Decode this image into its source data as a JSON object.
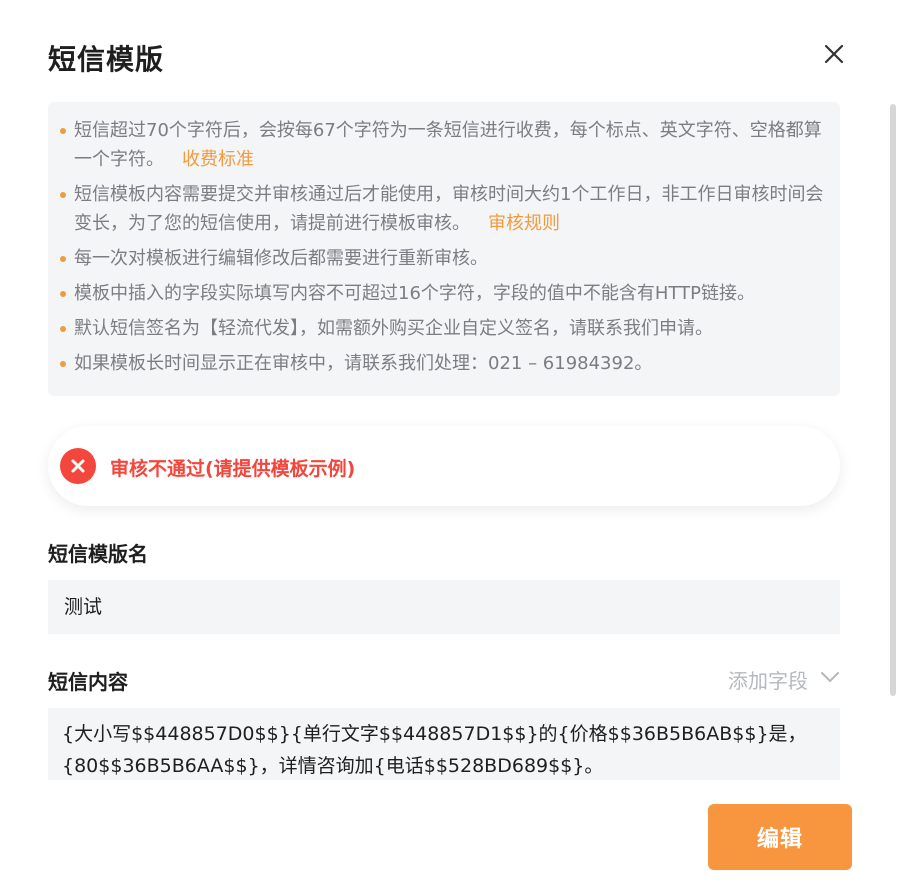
{
  "dialog": {
    "title": "短信模版"
  },
  "notice": {
    "items": [
      {
        "text": "短信超过70个字符后，会按每67个字符为一条短信进行收费，每个标点、英文字符、空格都算一个字符。",
        "link": "收费标准"
      },
      {
        "text": "短信模板内容需要提交并审核通过后才能使用，审核时间大约1个工作日，非工作日审核时间会变长，为了您的短信使用，请提前进行模板审核。",
        "link": "审核规则"
      },
      {
        "text": "每一次对模板进行编辑修改后都需要进行重新审核。"
      },
      {
        "text": "模板中插入的字段实际填写内容不可超过16个字符，字段的值中不能含有HTTP链接。"
      },
      {
        "text": "默认短信签名为【轻流代发】，如需额外购买企业自定义签名，请联系我们申请。"
      },
      {
        "text": "如果模板长时间显示正在审核中，请联系我们处理：021 – 61984392。"
      }
    ]
  },
  "status": {
    "text": "审核不通过(请提供模板示例)",
    "color": "#f3463c"
  },
  "form": {
    "name_label": "短信模版名",
    "name_value": "测试",
    "content_label": "短信内容",
    "add_field_label": "添加字段",
    "content_value": "{大小写$$448857D0$$}{单行文字$$448857D1$$}的{价格$$36B5B6AB$$}是，{80$$36B5B6AA$$}，详情咨询加{电话$$528BD689$$}。"
  },
  "footer": {
    "edit_label": "编辑"
  },
  "colors": {
    "accent": "#f7963f",
    "link": "#f39a3c",
    "error": "#f3463c",
    "panel_bg": "#f4f5f7"
  },
  "icons": {
    "close": "close-icon",
    "status": "error-circle-icon",
    "dropdown": "chevron-down-icon"
  }
}
